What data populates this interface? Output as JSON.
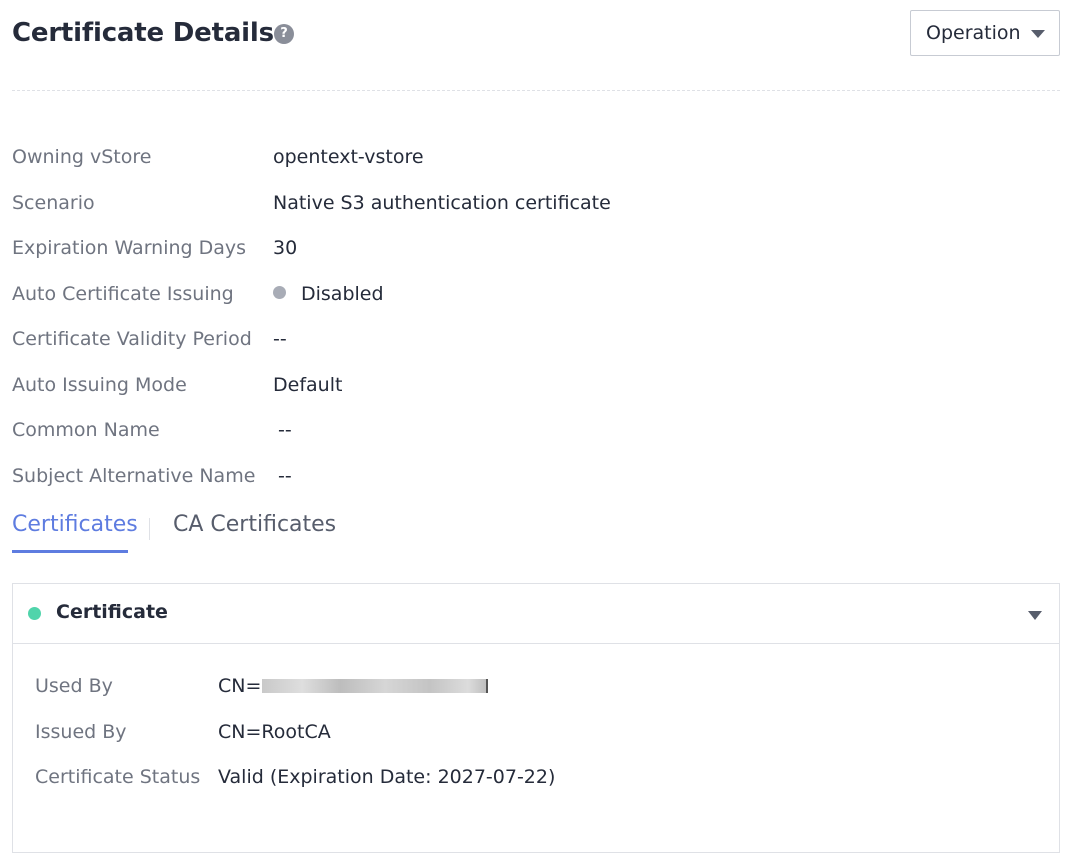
{
  "header": {
    "title": "Certificate Details",
    "help_icon": "?",
    "operation_label": "Operation"
  },
  "properties": [
    {
      "label": "Owning vStore",
      "value": "opentext-vstore"
    },
    {
      "label": "Scenario",
      "value": "Native S3 authentication certificate"
    },
    {
      "label": "Expiration Warning Days",
      "value": "30"
    },
    {
      "label": "Auto Certificate Issuing",
      "value": "Disabled",
      "status_color": "#a8acb6"
    },
    {
      "label": "Certificate Validity Period",
      "value": "--"
    },
    {
      "label": "Auto Issuing Mode",
      "value": "Default"
    },
    {
      "label": "Common Name",
      "value": "--"
    },
    {
      "label": "Subject Alternative Name",
      "value": "--"
    }
  ],
  "tabs": [
    {
      "label": "Certificates",
      "active": true
    },
    {
      "label": "CA Certificates",
      "active": false
    }
  ],
  "certificate_panel": {
    "title": "Certificate",
    "status_color": "#50d4ab",
    "rows": [
      {
        "label": "Used By",
        "value": "CN="
      },
      {
        "label": "Issued By",
        "value": "CN=RootCA"
      },
      {
        "label": "Certificate Status",
        "value": "Valid (Expiration Date: 2027-07-22)"
      }
    ]
  },
  "colors": {
    "accent": "#5e7ce0",
    "text_primary": "#252b3a",
    "text_secondary": "#6f7480"
  }
}
